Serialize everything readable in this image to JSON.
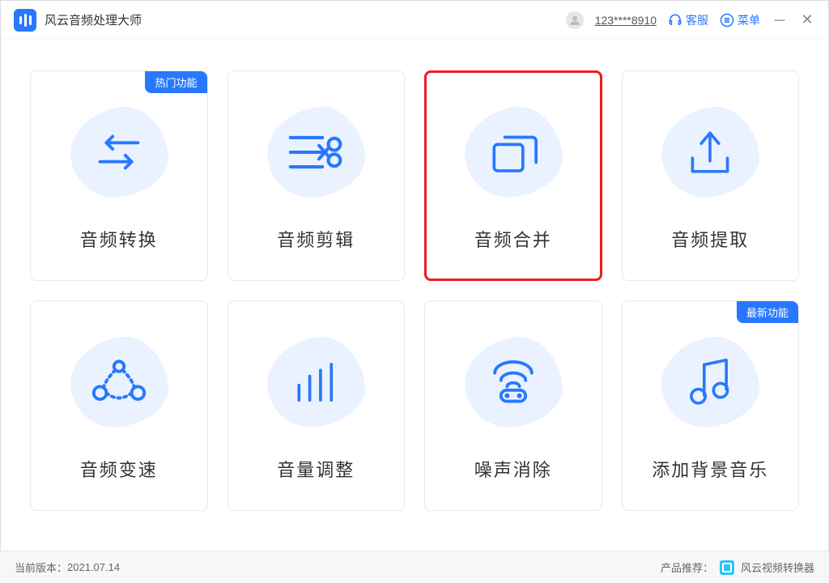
{
  "app": {
    "title": "风云音频处理大师"
  },
  "titlebar": {
    "user_id": "123****8910",
    "support_label": "客服",
    "menu_label": "菜单"
  },
  "badges": {
    "hot": "热门功能",
    "new": "最新功能"
  },
  "cards": [
    {
      "label": "音频转换",
      "icon": "convert",
      "badge": "hot",
      "highlighted": false
    },
    {
      "label": "音频剪辑",
      "icon": "cut",
      "badge": null,
      "highlighted": false
    },
    {
      "label": "音频合并",
      "icon": "merge",
      "badge": null,
      "highlighted": true
    },
    {
      "label": "音频提取",
      "icon": "extract",
      "badge": null,
      "highlighted": false
    },
    {
      "label": "音频变速",
      "icon": "speed",
      "badge": null,
      "highlighted": false
    },
    {
      "label": "音量调整",
      "icon": "volume",
      "badge": null,
      "highlighted": false
    },
    {
      "label": "噪声消除",
      "icon": "denoise",
      "badge": null,
      "highlighted": false
    },
    {
      "label": "添加背景音乐",
      "icon": "bgmusic",
      "badge": "new",
      "highlighted": false
    }
  ],
  "footer": {
    "version_prefix": "当前版本：",
    "version": "2021.07.14",
    "recommend_prefix": "产品推荐：",
    "recommend_product": "风云视频转换器"
  },
  "colors": {
    "primary": "#2878ff",
    "highlight_border": "#ed1c24",
    "blob": "#eaf2ff"
  }
}
